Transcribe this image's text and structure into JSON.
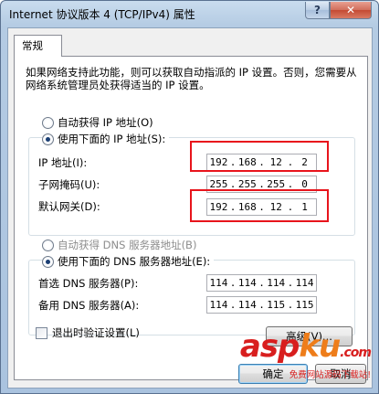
{
  "window": {
    "title": "Internet 协议版本 4 (TCP/IPv4) 属性",
    "help_label": "?",
    "close_label": "✕"
  },
  "tab": {
    "label": "常规"
  },
  "description": "如果网络支持此功能，则可以获取自动指派的 IP 设置。否则，您需要从网络系统管理员处获得适当的 IP 设置。",
  "ip": {
    "auto_label": "自动获得 IP 地址(O)",
    "manual_label": "使用下面的 IP 地址(S):",
    "address_label": "IP 地址(I):",
    "address": [
      "192",
      "168",
      "12",
      "2"
    ],
    "subnet_label": "子网掩码(U):",
    "subnet": [
      "255",
      "255",
      "255",
      "0"
    ],
    "gateway_label": "默认网关(D):",
    "gateway": [
      "192",
      "168",
      "12",
      "1"
    ]
  },
  "dns": {
    "auto_label": "自动获得 DNS 服务器地址(B)",
    "manual_label": "使用下面的 DNS 服务器地址(E):",
    "preferred_label": "首选 DNS 服务器(P):",
    "preferred": [
      "114",
      "114",
      "114",
      "114"
    ],
    "alternate_label": "备用 DNS 服务器(A):",
    "alternate": [
      "114",
      "114",
      "115",
      "115"
    ]
  },
  "validate_label": "退出时验证设置(L)",
  "advanced_label": "高级(V)...",
  "ok_label": "确定",
  "cancel_label": "取消",
  "watermark": {
    "logo_a": "asp",
    "logo_b": "ku",
    "tld": ".com",
    "sub": "免费网站源码下载站!"
  },
  "colors": {
    "highlight_box": "#e8141c",
    "watermark_red": "#d81e1e",
    "watermark_orange": "#ee7d1a"
  }
}
